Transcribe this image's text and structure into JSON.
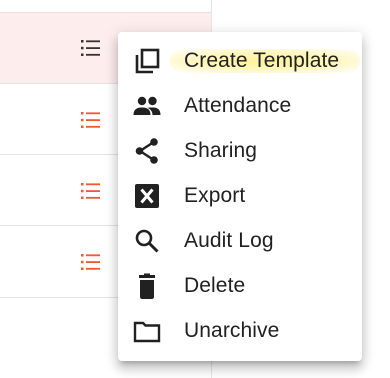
{
  "list": {
    "rows": [
      {
        "icon": "list-icon",
        "icon_color": "#333333",
        "highlighted": true
      },
      {
        "icon": "list-icon",
        "icon_color": "#f0582f",
        "highlighted": false
      },
      {
        "icon": "list-icon",
        "icon_color": "#f0582f",
        "highlighted": false
      },
      {
        "icon": "list-icon",
        "icon_color": "#f0582f",
        "highlighted": false
      }
    ]
  },
  "menu": {
    "items": [
      {
        "label": "Create Template",
        "icon": "copy-icon",
        "highlighted": true
      },
      {
        "label": "Attendance",
        "icon": "people-icon"
      },
      {
        "label": "Sharing",
        "icon": "share-icon"
      },
      {
        "label": "Export",
        "icon": "excel-export-icon"
      },
      {
        "label": "Audit Log",
        "icon": "search-icon"
      },
      {
        "label": "Delete",
        "icon": "trash-icon"
      },
      {
        "label": "Unarchive",
        "icon": "folder-icon"
      }
    ]
  },
  "colors": {
    "accent": "#f0582f",
    "row_highlight": "#fdeeed",
    "menu_highlight": "#fff196",
    "text": "#212121",
    "icon_dark": "#212121"
  }
}
